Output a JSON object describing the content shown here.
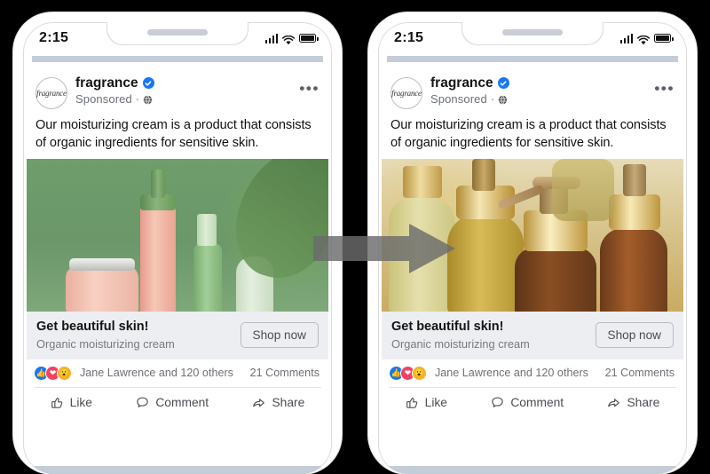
{
  "meta": {
    "background_color": "#000000",
    "phone_frame_color": "#ffffff",
    "accent_blue": "#1877F2",
    "appbar_color": "#c4ccd8"
  },
  "arrow": {
    "name": "transition-arrow",
    "direction": "right",
    "color": "#6b6b6b"
  },
  "phones": [
    {
      "id": "left",
      "status": {
        "time": "2:15",
        "signal_icon": "signal-bars-icon",
        "wifi_icon": "wifi-icon",
        "battery_icon": "battery-icon"
      },
      "post": {
        "avatar_label": "fragrance",
        "brand": "fragrance",
        "verified_icon": "verified-badge-icon",
        "sponsored": "Sponsored",
        "separator": "·",
        "audience_icon": "globe-icon",
        "more_icon": "more-options-icon",
        "more_label": "•••",
        "caption": "Our moisturizing cream is a product that consists of organic ingredients for sensitive skin.",
        "creative_alt": "green cosmetic bottles",
        "creative_variant": "g1",
        "ad_title": "Get beautiful skin!",
        "ad_subtitle": "Organic moisturizing cream",
        "cta_label": "Shop now"
      },
      "engagement": {
        "reactions": [
          {
            "name": "reaction-like-icon",
            "glyph": "👍",
            "color": "#1877F2"
          },
          {
            "name": "reaction-love-icon",
            "glyph": "❤",
            "color": "#F3425F"
          },
          {
            "name": "reaction-wow-icon",
            "glyph": "😮",
            "color": "#F7B125"
          }
        ],
        "names": "Jane Lawrence and 120 others",
        "comments": "21 Comments"
      },
      "actions": [
        {
          "name": "like-button",
          "label": "Like",
          "icon": "thumbs-up-icon"
        },
        {
          "name": "comment-button",
          "label": "Comment",
          "icon": "comment-bubble-icon"
        },
        {
          "name": "share-button",
          "label": "Share",
          "icon": "share-arrow-icon"
        }
      ]
    },
    {
      "id": "right",
      "status": {
        "time": "2:15",
        "signal_icon": "signal-bars-icon",
        "wifi_icon": "wifi-icon",
        "battery_icon": "battery-icon"
      },
      "post": {
        "avatar_label": "fragrance",
        "brand": "fragrance",
        "verified_icon": "verified-badge-icon",
        "sponsored": "Sponsored",
        "separator": "·",
        "audience_icon": "globe-icon",
        "more_icon": "more-options-icon",
        "more_label": "•••",
        "caption": "Our moisturizing cream is a product that consists of organic ingredients for sensitive skin.",
        "creative_alt": "amber pump bottles",
        "creative_variant": "g2",
        "ad_title": "Get beautiful skin!",
        "ad_subtitle": "Organic moisturizing cream",
        "cta_label": "Shop now"
      },
      "engagement": {
        "reactions": [
          {
            "name": "reaction-like-icon",
            "glyph": "👍",
            "color": "#1877F2"
          },
          {
            "name": "reaction-love-icon",
            "glyph": "❤",
            "color": "#F3425F"
          },
          {
            "name": "reaction-wow-icon",
            "glyph": "😮",
            "color": "#F7B125"
          }
        ],
        "names": "Jane Lawrence and 120 others",
        "comments": "21 Comments"
      },
      "actions": [
        {
          "name": "like-button",
          "label": "Like",
          "icon": "thumbs-up-icon"
        },
        {
          "name": "comment-button",
          "label": "Comment",
          "icon": "comment-bubble-icon"
        },
        {
          "name": "share-button",
          "label": "Share",
          "icon": "share-arrow-icon"
        }
      ]
    }
  ]
}
